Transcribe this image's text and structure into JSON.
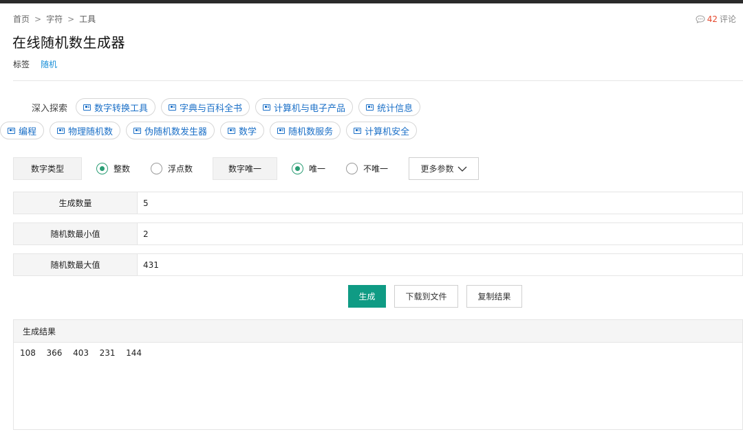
{
  "breadcrumb": {
    "home": "首页",
    "sep": ">",
    "category": "字符",
    "current": "工具"
  },
  "comments": {
    "count": "42",
    "label": "评论",
    "count_color": "#e5482d"
  },
  "page": {
    "title": "在线随机数生成器"
  },
  "tags": {
    "label": "标签",
    "items": [
      "随机"
    ]
  },
  "explore": {
    "label": "深入探索",
    "row1": [
      "数字转换工具",
      "字典与百科全书",
      "计算机与电子产品",
      "统计信息"
    ],
    "row2": [
      "编程",
      "物理随机数",
      "伪随机数发生器",
      "数学",
      "随机数服务",
      "计算机安全"
    ]
  },
  "options": {
    "number_type_label": "数字类型",
    "integer_label": "整数",
    "float_label": "浮点数",
    "unique_label": "数字唯一",
    "unique_yes_label": "唯一",
    "unique_no_label": "不唯一",
    "more_label": "更多参数",
    "number_type_selected": "整数",
    "unique_selected": "唯一",
    "accent_color": "#2a9d74"
  },
  "fields": {
    "count": {
      "label": "生成数量",
      "value": "5"
    },
    "min": {
      "label": "随机数最小值",
      "value": "2"
    },
    "max": {
      "label": "随机数最大值",
      "value": "431"
    }
  },
  "actions": {
    "generate_label": "生成",
    "download_label": "下载到文件",
    "copy_label": "复制结果",
    "primary_color": "#0f9b84"
  },
  "result": {
    "header": "生成结果",
    "values": "108  366  403  231  144"
  }
}
